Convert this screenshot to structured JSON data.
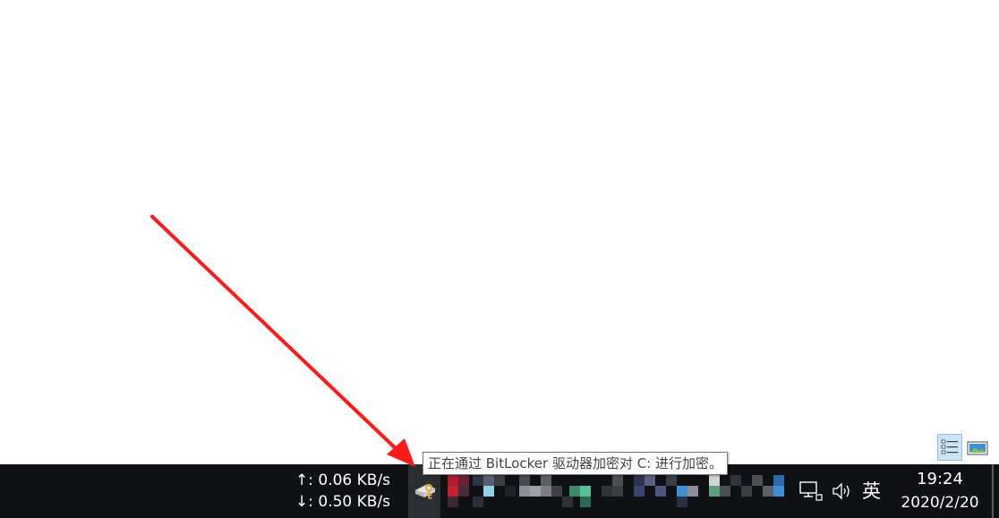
{
  "net_speed": {
    "upload": "↑: 0.06 KB/s",
    "download": "↓: 0.50 KB/s"
  },
  "tooltip": {
    "text": "正在通过 BitLocker 驱动器加密对 C: 进行加密。"
  },
  "ime": {
    "label": "英"
  },
  "clock": {
    "time": "19:24",
    "date": "2020/2/20"
  },
  "icons": {
    "bitlocker": "bitlocker-key-icon",
    "network": "network-icon",
    "volume": "volume-icon",
    "details_view": "details-view-icon",
    "large_icons_view": "large-icons-view-icon"
  },
  "colors": {
    "taskbar": "#0f1114",
    "annotation_arrow": "#ff1a1a",
    "tooltip_border": "#767676"
  }
}
